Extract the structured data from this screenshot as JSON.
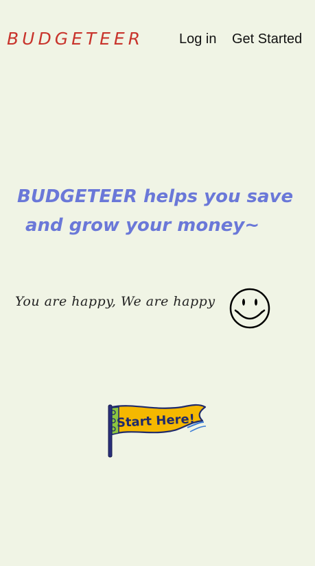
{
  "header": {
    "logo": "BUDGETEER",
    "nav": {
      "login": "Log in",
      "get_started": "Get Started"
    }
  },
  "hero": {
    "headline_line1": "BUDGETEER helps you save",
    "headline_line2": "and grow your money~",
    "tagline": "You are happy, We are happy",
    "smiley_icon": "smiley-face-icon",
    "cta_label": "Start Here!"
  },
  "colors": {
    "background": "#f0f4e5",
    "logo": "#c8342c",
    "headline": "#6a78d8",
    "flag_fill": "#f5b800",
    "flag_outline": "#1f2a6b"
  }
}
